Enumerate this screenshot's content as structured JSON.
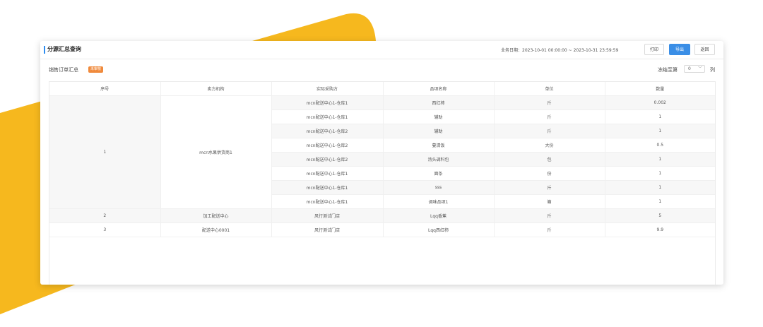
{
  "header": {
    "title": "分源汇总查询",
    "biz_date": "业务日期：2023-10-01 00:00:00 ~ 2023-10-31 23:59:59",
    "buttons": {
      "print": "打印",
      "export": "导出",
      "back": "返回"
    }
  },
  "toolbar": {
    "summary_label": "销售订单汇总",
    "status_badge": "未审核",
    "freeze_prefix": "冻结至第",
    "freeze_value": "0",
    "freeze_suffix": "列"
  },
  "table": {
    "columns": [
      "序号",
      "卖方机构",
      "实际采购方",
      "品项名称",
      "单位",
      "数量"
    ],
    "groups": [
      {
        "index": "1",
        "seller": "mcn水果供货商1",
        "rows": [
          {
            "buyer": "mcn配送中心1-仓库1",
            "item": "西红柿",
            "unit": "斤",
            "qty": "0.002"
          },
          {
            "buyer": "mcn配送中心1-仓库1",
            "item": "辅助",
            "unit": "斤",
            "qty": "1"
          },
          {
            "buyer": "mcn配送中心1-仓库2",
            "item": "辅助",
            "unit": "斤",
            "qty": "1"
          },
          {
            "buyer": "mcn配送中心1-仓库2",
            "item": "蔓清饭",
            "unit": "大份",
            "qty": "0.5"
          },
          {
            "buyer": "mcn配送中心1-仓库2",
            "item": "汤头调料包",
            "unit": "包",
            "qty": "1"
          },
          {
            "buyer": "mcn配送中心1-仓库1",
            "item": "面条",
            "unit": "份",
            "qty": "1"
          },
          {
            "buyer": "mcn配送中心1-仓库1",
            "item": "sss",
            "unit": "斤",
            "qty": "1"
          },
          {
            "buyer": "mcn配送中心1-仓库1",
            "item": "调味品项1",
            "unit": "箱",
            "qty": "1"
          }
        ]
      },
      {
        "index": "2",
        "seller": "加工配送中心",
        "rows": [
          {
            "buyer": "风行测试门店",
            "item": "Lqq香蕉",
            "unit": "斤",
            "qty": "5"
          }
        ]
      },
      {
        "index": "3",
        "seller": "配送中心0001",
        "rows": [
          {
            "buyer": "风行测试门店",
            "item": "Lqq西红柿",
            "unit": "斤",
            "qty": "9.9"
          }
        ]
      }
    ]
  },
  "colors": {
    "accent": "#3a8ee6",
    "badge": "#f08a3c",
    "background_shape": "#f6b81e"
  }
}
